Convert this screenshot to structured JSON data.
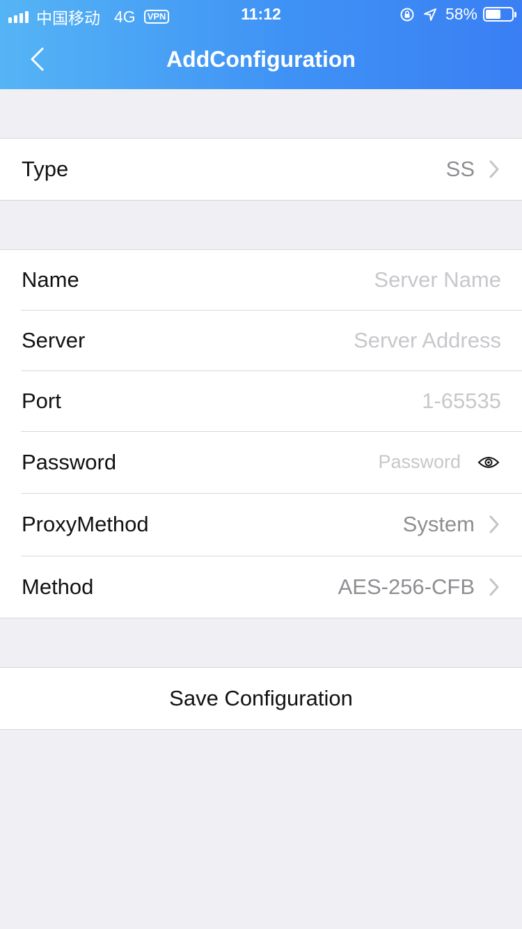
{
  "status_bar": {
    "carrier": "中国移动",
    "network": "4G",
    "vpn": "VPN",
    "time": "11:12",
    "battery_percent": "58%",
    "battery_level": 0.58
  },
  "nav": {
    "title": "AddConfiguration",
    "back_icon": "chevron-left-icon"
  },
  "type_group": {
    "label": "Type",
    "value": "SS"
  },
  "form": {
    "name": {
      "label": "Name",
      "placeholder": "Server Name"
    },
    "server": {
      "label": "Server",
      "placeholder": "Server Address"
    },
    "port": {
      "label": "Port",
      "placeholder": "1-65535"
    },
    "password": {
      "label": "Password",
      "placeholder": "Password",
      "toggle_icon": "eye-icon"
    },
    "proxy_method": {
      "label": "ProxyMethod",
      "value": "System"
    },
    "method": {
      "label": "Method",
      "value": "AES-256-CFB"
    }
  },
  "actions": {
    "save_label": "Save Configuration"
  },
  "colors": {
    "header_gradient_start": "#55b4f5",
    "header_gradient_end": "#3a7ff4",
    "background": "#efeff4",
    "placeholder": "#c7c7cc",
    "secondary_text": "#8e8e93"
  }
}
